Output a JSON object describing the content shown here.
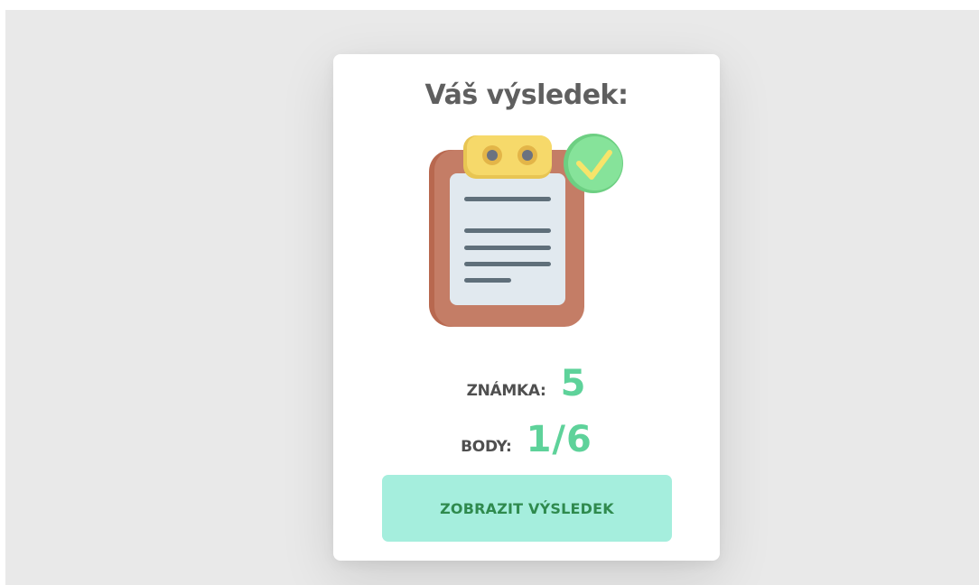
{
  "result": {
    "title": "Váš výsledek:",
    "grade_label": "ZNÁMKA:",
    "grade_value": "5",
    "points_label": "BODY:",
    "points_value": "1/6",
    "show_button_label": "ZOBRAZIT VÝSLEDEK"
  },
  "icons": {
    "illustration": "clipboard-checkmark-icon"
  },
  "colors": {
    "background": "#e9e9e9",
    "card": "#ffffff",
    "title_text": "#5f5f5f",
    "value_accent": "#5ed29a",
    "button_bg": "#a5eedd",
    "button_text": "#2f8a4e",
    "clipboard_board": "#c47d66",
    "clip": "#f6d96a",
    "check_badge": "#7ed88f"
  }
}
